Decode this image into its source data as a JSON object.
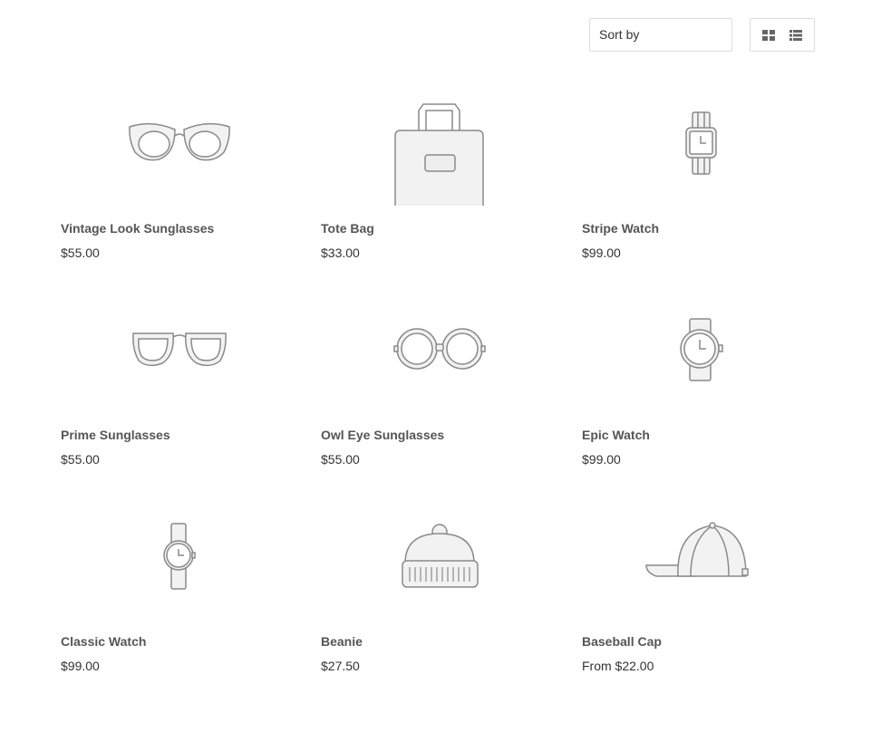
{
  "toolbar": {
    "sort_label": "Sort by",
    "grid_view_icon": "grid-view-icon",
    "list_view_icon": "list-view-icon"
  },
  "colors": {
    "icon_stroke": "#8a8a8a",
    "icon_fill": "#f2f2f2",
    "toggle_icon": "#666666"
  },
  "products": [
    {
      "title": "Vintage Look Sunglasses",
      "price": "$55.00",
      "icon": "cat-eye-sunglasses-icon"
    },
    {
      "title": "Tote Bag",
      "price": "$33.00",
      "icon": "tote-bag-icon"
    },
    {
      "title": "Stripe Watch",
      "price": "$99.00",
      "icon": "square-watch-icon"
    },
    {
      "title": "Prime Sunglasses",
      "price": "$55.00",
      "icon": "wayfarer-sunglasses-icon"
    },
    {
      "title": "Owl Eye Sunglasses",
      "price": "$55.00",
      "icon": "round-sunglasses-icon"
    },
    {
      "title": "Epic Watch",
      "price": "$99.00",
      "icon": "round-watch-icon"
    },
    {
      "title": "Classic Watch",
      "price": "$99.00",
      "icon": "classic-watch-icon"
    },
    {
      "title": "Beanie",
      "price": "$27.50",
      "icon": "beanie-icon"
    },
    {
      "title": "Baseball Cap",
      "price": "From $22.00",
      "icon": "baseball-cap-icon"
    }
  ]
}
